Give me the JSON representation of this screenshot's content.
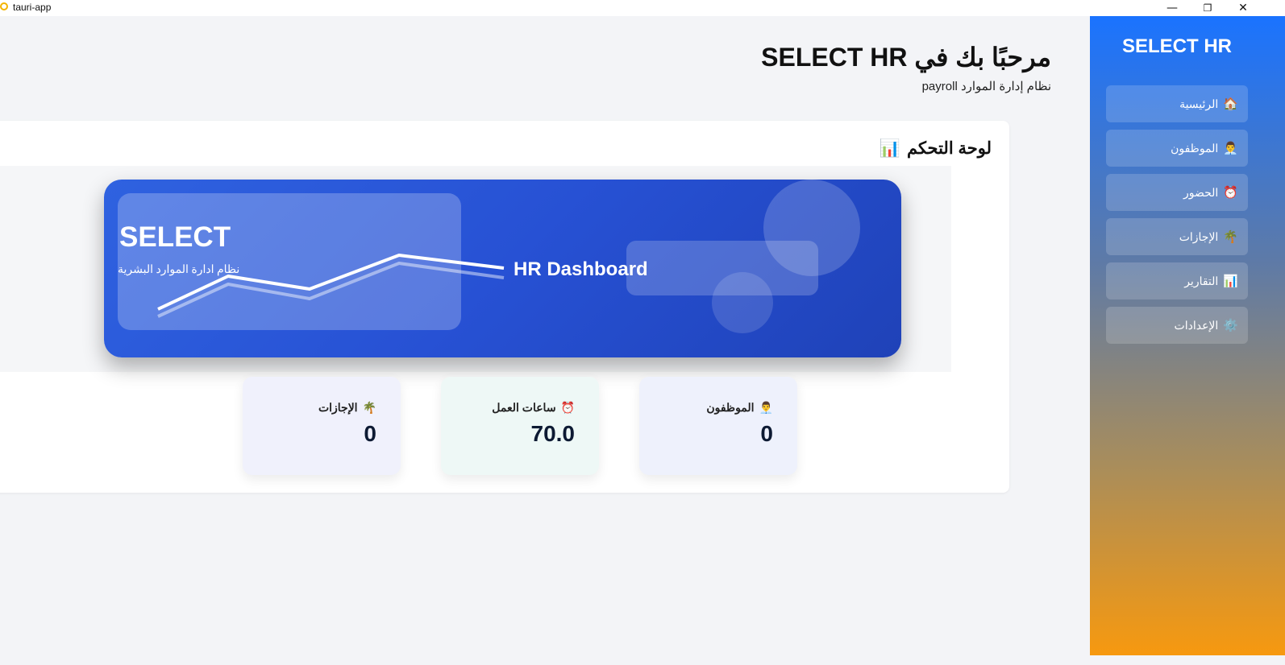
{
  "window": {
    "title": "tauri-app"
  },
  "sidebar": {
    "title": "SELECT HR",
    "items": [
      {
        "icon": "🏠",
        "label": "الرئيسية"
      },
      {
        "icon": "👨‍💼",
        "label": "الموظفون"
      },
      {
        "icon": "⏰",
        "label": "الحضور"
      },
      {
        "icon": "🌴",
        "label": "الإجازات"
      },
      {
        "icon": "📊",
        "label": "التقارير"
      },
      {
        "icon": "⚙️",
        "label": "الإعدادات"
      }
    ]
  },
  "header": {
    "welcome": "مرحبًا بك في SELECT HR",
    "subtitle": "نظام إدارة الموارد payroll"
  },
  "dashboard": {
    "icon": "📊",
    "title": "لوحة التحكم",
    "banner": {
      "brand": "SELECT",
      "tagline": "نظام ادارة الموارد البشرية",
      "caption": "HR Dashboard"
    },
    "stats": [
      {
        "icon": "👨‍💼",
        "label": "الموظفون",
        "value": "0",
        "bg": "#eef1fc"
      },
      {
        "icon": "⏰",
        "label": "ساعات العمل",
        "value": "70.0",
        "bg": "#eef8f6"
      },
      {
        "icon": "🌴",
        "label": "الإجازات",
        "value": "0",
        "bg": "#f0f1fc"
      }
    ]
  },
  "colors": {
    "sidebar_top": "#1a73ff",
    "sidebar_bottom": "#f7990f",
    "banner_blue": "#2751d4"
  }
}
